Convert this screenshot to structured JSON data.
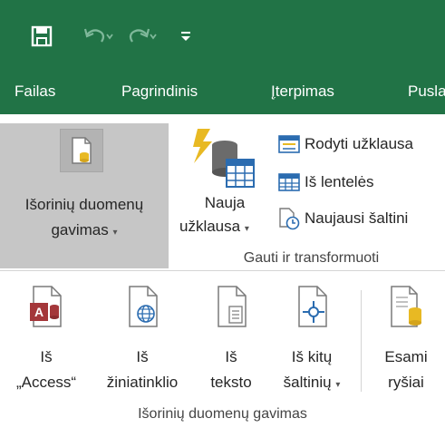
{
  "quick_access": {
    "save_icon": "save-icon",
    "undo_icon": "undo-icon",
    "redo_icon": "redo-icon",
    "customize_icon": "customize-arrow-icon"
  },
  "tabs": {
    "file": "Failas",
    "home": "Pagrindinis",
    "insert_first": "Į",
    "insert_rest": "terpimas",
    "page_layout": "Pusla"
  },
  "ribbon": {
    "external_data": {
      "line1": "Išorinių duomenų",
      "line2": "gavimas"
    },
    "new_query": {
      "line1": "Nauja",
      "line2": "užklausa"
    },
    "show_queries": "Rodyti užklausa",
    "from_table": "Iš lentelės",
    "recent_sources": "Naujausi šaltini",
    "group_label": "Gauti ir transformuoti",
    "dropdown_caret": "▾"
  },
  "gallery": {
    "from_access": {
      "line1": "Iš",
      "line2": "„Access“"
    },
    "from_web": {
      "line1": "Iš",
      "line2": "žiniatinklio"
    },
    "from_text": {
      "line1": "Iš",
      "line2": "teksto"
    },
    "from_other": {
      "line1": "Iš kitų",
      "line2": "šaltinių"
    },
    "existing_connections": {
      "line1": "Esami",
      "line2": "ryšiai"
    },
    "group_label": "Išorinių duomenų gavimas"
  },
  "colors": {
    "title_green": "#217346",
    "access_red": "#a4373a",
    "gold": "#e8b923",
    "blue": "#2b6cb0"
  }
}
